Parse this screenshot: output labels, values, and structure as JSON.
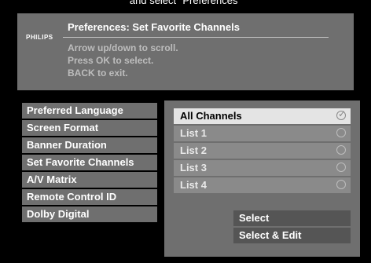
{
  "top_caption": "and select \"Preferences\"",
  "header": {
    "brand": "PHILIPS",
    "title": "Preferences: Set Favorite Channels",
    "instructions": [
      "Arrow up/down to scroll.",
      "Press OK to select.",
      "BACK to exit."
    ]
  },
  "menu": {
    "items": [
      "Preferred Language",
      "Screen Format",
      "Banner Duration",
      "Set Favorite Channels",
      "A/V Matrix",
      "Remote Control ID",
      "Dolby Digital"
    ]
  },
  "channels": {
    "rows": [
      {
        "label": "All Channels",
        "selected": true
      },
      {
        "label": "List 1",
        "selected": false
      },
      {
        "label": "List 2",
        "selected": false
      },
      {
        "label": "List 3",
        "selected": false
      },
      {
        "label": "List 4",
        "selected": false
      }
    ],
    "checkmark_icon": "✓"
  },
  "actions": {
    "select_label": "Select",
    "select_edit_label": "Select & Edit"
  },
  "colors": {
    "panel": "#6f6f6f",
    "row": "#8a8a8a",
    "row_selected": "#e4e4e4",
    "button": "#555555",
    "background": "#000000"
  }
}
